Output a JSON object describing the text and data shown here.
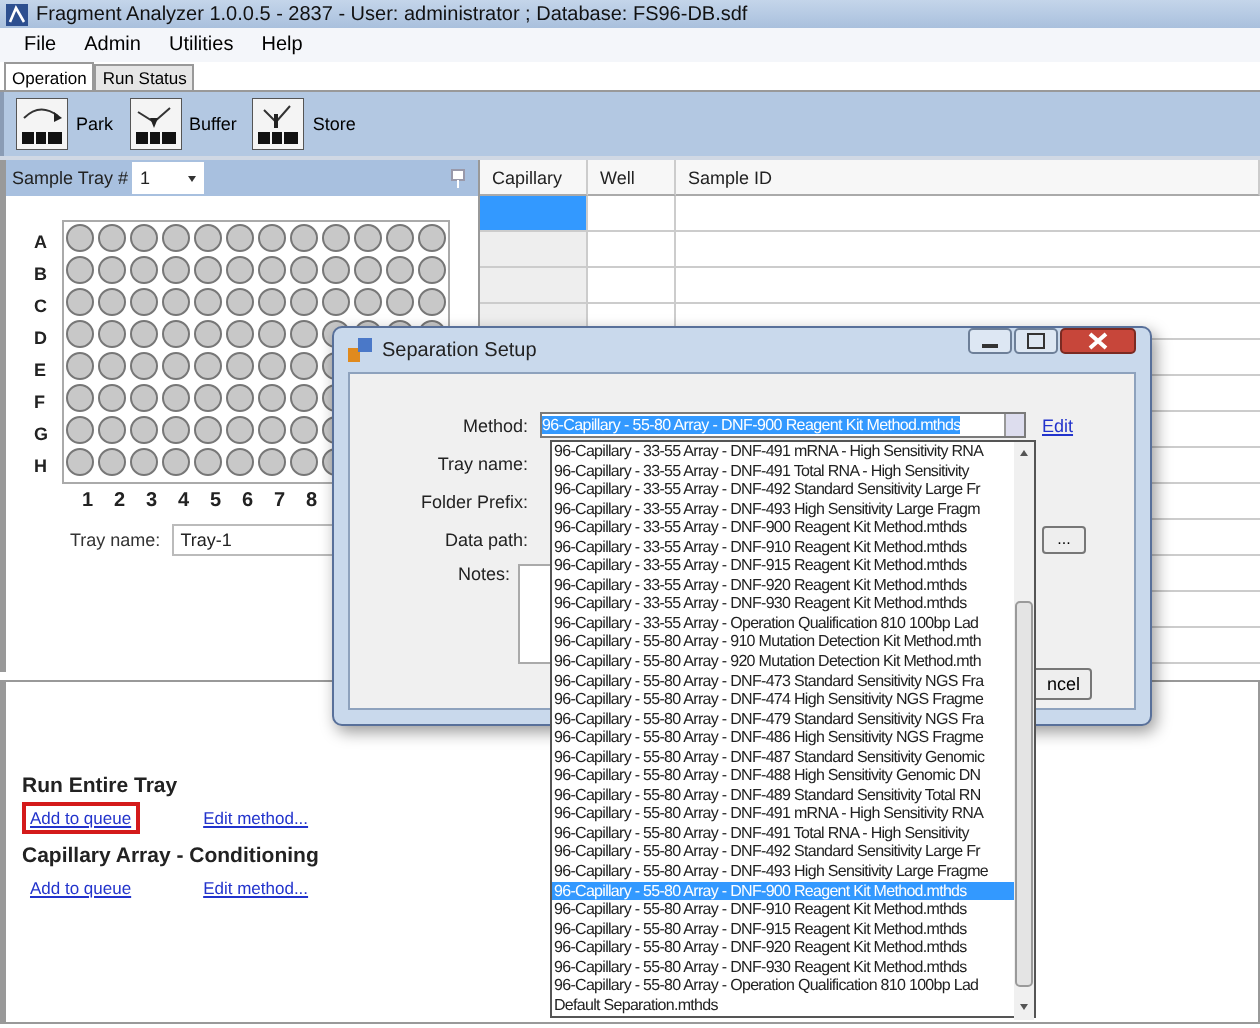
{
  "window": {
    "title": "Fragment Analyzer 1.0.0.5 - 2837 - User: administrator ; Database: FS96-DB.sdf"
  },
  "menu": [
    "File",
    "Admin",
    "Utilities",
    "Help"
  ],
  "tabs": [
    {
      "label": "Operation",
      "selected": true
    },
    {
      "label": "Run Status",
      "selected": false
    }
  ],
  "toolbar": [
    {
      "label": "Park",
      "kind": "park"
    },
    {
      "label": "Buffer",
      "kind": "buffer"
    },
    {
      "label": "Store",
      "kind": "store"
    }
  ],
  "sample_tray": {
    "label": "Sample Tray #",
    "value": "1",
    "rows": [
      "A",
      "B",
      "C",
      "D",
      "E",
      "F",
      "G",
      "H"
    ],
    "columns": [
      "1",
      "2",
      "3",
      "4",
      "5",
      "6",
      "7",
      "8"
    ],
    "tray_name_label": "Tray name:",
    "tray_name": "Tray-1"
  },
  "table": {
    "columns": [
      "Capillary",
      "Well",
      "Sample ID"
    ],
    "rows": [
      {
        "selected": true
      },
      {
        "selected": false
      },
      {
        "selected": false
      }
    ]
  },
  "sections": [
    {
      "title": "Run Entire Tray",
      "links": [
        {
          "label": "Add to queue",
          "highlighted": true
        },
        {
          "label": "Edit method...",
          "highlighted": false
        }
      ]
    },
    {
      "title": "Capillary Array - Conditioning",
      "links": [
        {
          "label": "Add to queue",
          "highlighted": false
        },
        {
          "label": "Edit method...",
          "highlighted": false
        }
      ]
    }
  ],
  "dialog": {
    "title": "Separation Setup",
    "method_label": "Method:",
    "method_value": "96-Capillary - 55-80 Array - DNF-900 Reagent Kit Method.mthds",
    "edit_link": "Edit",
    "tray_name_label": "Tray name:",
    "folder_prefix_label": "Folder Prefix:",
    "data_path_label": "Data path:",
    "browse_button": "...",
    "notes_label": "Notes:",
    "cancel_button": "ncel",
    "options": [
      {
        "label": "96-Capillary - 33-55 Array - DNF-491 mRNA - High Sensitivity RNA",
        "selected": false
      },
      {
        "label": "96-Capillary - 33-55 Array - DNF-491 Total RNA - High Sensitivity",
        "selected": false
      },
      {
        "label": "96-Capillary - 33-55 Array - DNF-492 Standard Sensitivity Large Fr",
        "selected": false
      },
      {
        "label": "96-Capillary - 33-55 Array - DNF-493 High Sensitivity Large Fragm",
        "selected": false
      },
      {
        "label": "96-Capillary - 33-55 Array - DNF-900 Reagent Kit Method.mthds",
        "selected": false
      },
      {
        "label": "96-Capillary - 33-55 Array - DNF-910 Reagent Kit Method.mthds",
        "selected": false
      },
      {
        "label": "96-Capillary - 33-55 Array - DNF-915 Reagent Kit Method.mthds",
        "selected": false
      },
      {
        "label": "96-Capillary - 33-55 Array - DNF-920 Reagent Kit Method.mthds",
        "selected": false
      },
      {
        "label": "96-Capillary - 33-55 Array - DNF-930 Reagent Kit Method.mthds",
        "selected": false
      },
      {
        "label": "96-Capillary - 33-55 Array - Operation Qualification 810 100bp Lad",
        "selected": false
      },
      {
        "label": "96-Capillary - 55-80 Array - 910 Mutation Detection Kit Method.mth",
        "selected": false
      },
      {
        "label": "96-Capillary - 55-80 Array - 920 Mutation Detection Kit Method.mth",
        "selected": false
      },
      {
        "label": "96-Capillary - 55-80 Array - DNF-473 Standard Sensitivity NGS Fra",
        "selected": false
      },
      {
        "label": "96-Capillary - 55-80 Array - DNF-474 High Sensitivity NGS Fragme",
        "selected": false
      },
      {
        "label": "96-Capillary - 55-80 Array - DNF-479 Standard Sensitivity NGS Fra",
        "selected": false
      },
      {
        "label": "96-Capillary - 55-80 Array - DNF-486 High Sensitivity NGS Fragme",
        "selected": false
      },
      {
        "label": "96-Capillary - 55-80 Array - DNF-487 Standard Sensitivity Genomic",
        "selected": false
      },
      {
        "label": "96-Capillary - 55-80 Array - DNF-488 High Sensitivity Genomic DN",
        "selected": false
      },
      {
        "label": "96-Capillary - 55-80 Array - DNF-489 Standard Sensitivity Total RN",
        "selected": false
      },
      {
        "label": "96-Capillary - 55-80 Array - DNF-491 mRNA - High Sensitivity RNA",
        "selected": false
      },
      {
        "label": "96-Capillary - 55-80 Array - DNF-491 Total RNA - High Sensitivity",
        "selected": false
      },
      {
        "label": "96-Capillary - 55-80 Array - DNF-492 Standard Sensitivity Large Fr",
        "selected": false
      },
      {
        "label": "96-Capillary - 55-80 Array - DNF-493 High Sensitivity Large Fragme",
        "selected": false
      },
      {
        "label": "96-Capillary - 55-80 Array - DNF-900 Reagent Kit Method.mthds",
        "selected": true
      },
      {
        "label": "96-Capillary - 55-80 Array - DNF-910 Reagent Kit Method.mthds",
        "selected": false
      },
      {
        "label": "96-Capillary - 55-80 Array - DNF-915 Reagent Kit Method.mthds",
        "selected": false
      },
      {
        "label": "96-Capillary - 55-80 Array - DNF-920 Reagent Kit Method.mthds",
        "selected": false
      },
      {
        "label": "96-Capillary - 55-80 Array - DNF-930 Reagent Kit Method.mthds",
        "selected": false
      },
      {
        "label": "96-Capillary - 55-80 Array - Operation Qualification 810 100bp Lad",
        "selected": false
      },
      {
        "label": "Default Separation.mthds",
        "selected": false
      }
    ]
  }
}
